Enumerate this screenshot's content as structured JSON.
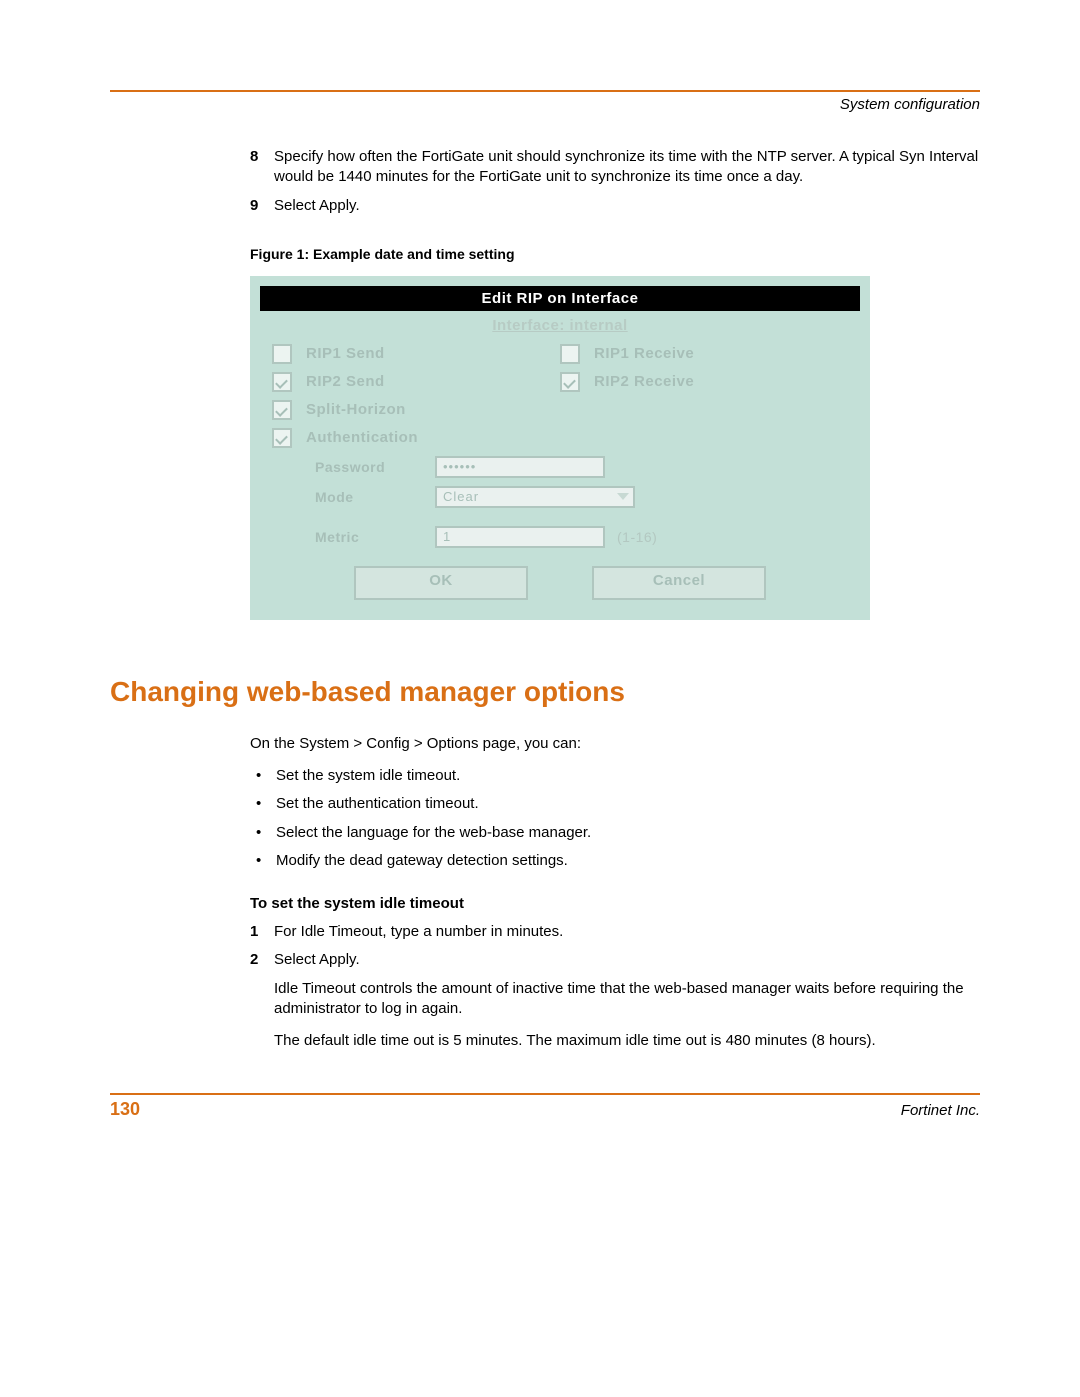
{
  "header": {
    "section_label": "System configuration"
  },
  "steps_a": [
    {
      "num": "8",
      "text": "Specify how often the FortiGate unit should synchronize its time with the NTP server. A typical Syn Interval would be 1440 minutes for the FortiGate unit to synchronize its time once a day."
    },
    {
      "num": "9",
      "text": "Select Apply."
    }
  ],
  "figure": {
    "caption": "Figure 1: Example date and time setting",
    "title": "Edit RIP on Interface",
    "subtitle": "Interface: internal",
    "checkboxes": [
      {
        "label": "RIP1 Send",
        "checked": false
      },
      {
        "label": "RIP1 Receive",
        "checked": false
      },
      {
        "label": "RIP2 Send",
        "checked": true
      },
      {
        "label": "RIP2 Receive",
        "checked": true
      },
      {
        "label": "Split-Horizon",
        "checked": true
      },
      {
        "label": "Authentication",
        "checked": true
      }
    ],
    "fields": {
      "password_label": "Password",
      "password_value": "••••••",
      "mode_label": "Mode",
      "mode_value": "Clear",
      "metric_label": "Metric",
      "metric_value": "1",
      "metric_hint": "(1-16)"
    },
    "buttons": {
      "ok": "OK",
      "cancel": "Cancel"
    }
  },
  "heading": "Changing web-based manager options",
  "intro": "On the System > Config > Options page, you can:",
  "bullets": [
    "Set the system idle timeout.",
    "Set the authentication timeout.",
    "Select the language for the web-base manager.",
    "Modify the dead gateway detection settings."
  ],
  "subhead": "To set the system idle timeout",
  "steps_b": [
    {
      "num": "1",
      "text": "For Idle Timeout, type a number in minutes."
    },
    {
      "num": "2",
      "text": "Select Apply."
    }
  ],
  "after_text": [
    "Idle Timeout controls the amount of inactive time that the web-based manager waits before requiring the administrator to log in again.",
    "The default idle time out is 5 minutes. The maximum idle time out is 480 minutes (8 hours)."
  ],
  "footer": {
    "page": "130",
    "company": "Fortinet Inc."
  }
}
